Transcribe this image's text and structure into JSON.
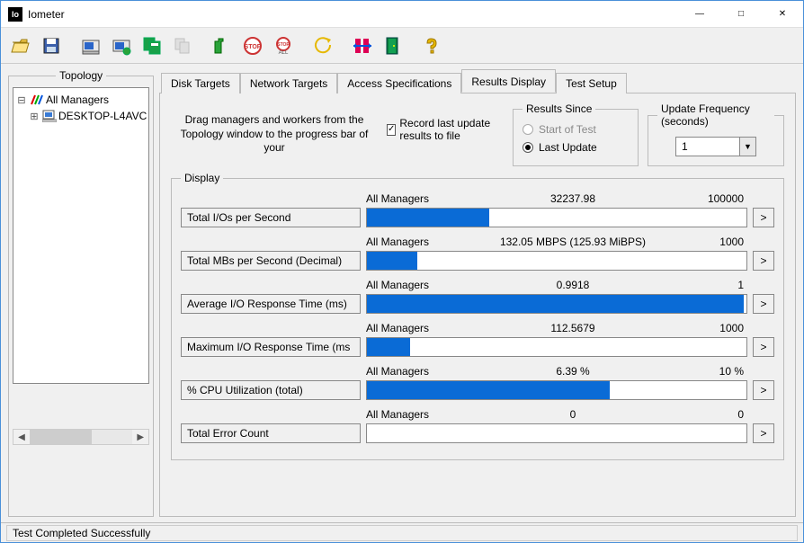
{
  "title": "Iometer",
  "app_icon_text": "Io",
  "toolbar": [
    {
      "name": "open-icon"
    },
    {
      "name": "save-icon"
    },
    {
      "sep": true
    },
    {
      "name": "new-worker-disk-icon"
    },
    {
      "name": "new-worker-net-icon"
    },
    {
      "name": "duplicate-worker-icon"
    },
    {
      "name": "copy-worker-icon",
      "disabled": true
    },
    {
      "sep": true
    },
    {
      "name": "start-tests-icon"
    },
    {
      "name": "stop-current-icon"
    },
    {
      "name": "stop-all-icon"
    },
    {
      "sep": true
    },
    {
      "name": "reset-workers-icon"
    },
    {
      "sep": true
    },
    {
      "name": "align-icon"
    },
    {
      "name": "exit-icon"
    },
    {
      "sep": true
    },
    {
      "name": "about-icon"
    }
  ],
  "topology": {
    "title": "Topology",
    "root": "All Managers",
    "child": "DESKTOP-L4AVC"
  },
  "tabs": [
    "Disk Targets",
    "Network Targets",
    "Access Specifications",
    "Results Display",
    "Test Setup"
  ],
  "active_tab": 3,
  "instructions": "Drag managers and workers from the Topology window to the progress bar of your",
  "record": {
    "label": "Record last update results to file",
    "checked": true
  },
  "results_since": {
    "title": "Results Since",
    "opt_start": "Start of Test",
    "opt_last": "Last Update",
    "selected": "last"
  },
  "update_freq": {
    "title": "Update Frequency (seconds)",
    "value": "1"
  },
  "display_title": "Display",
  "metrics": [
    {
      "label": "Total I/Os per Second",
      "src": "All Managers",
      "val": "32237.98",
      "max": "100000",
      "pct": 32.2
    },
    {
      "label": "Total MBs per Second (Decimal)",
      "src": "All Managers",
      "val": "132.05 MBPS (125.93 MiBPS)",
      "max": "1000",
      "pct": 13.2
    },
    {
      "label": "Average I/O Response Time (ms)",
      "src": "All Managers",
      "val": "0.9918",
      "max": "1",
      "pct": 99.2
    },
    {
      "label": "Maximum I/O Response Time (ms",
      "src": "All Managers",
      "val": "112.5679",
      "max": "1000",
      "pct": 11.3
    },
    {
      "label": "% CPU Utilization (total)",
      "src": "All Managers",
      "val": "6.39 %",
      "max": "10 %",
      "pct": 63.9
    },
    {
      "label": "Total Error Count",
      "src": "All Managers",
      "val": "0",
      "max": "0",
      "pct": 0
    }
  ],
  "status": "Test Completed Successfully",
  "more_symbol": ">"
}
